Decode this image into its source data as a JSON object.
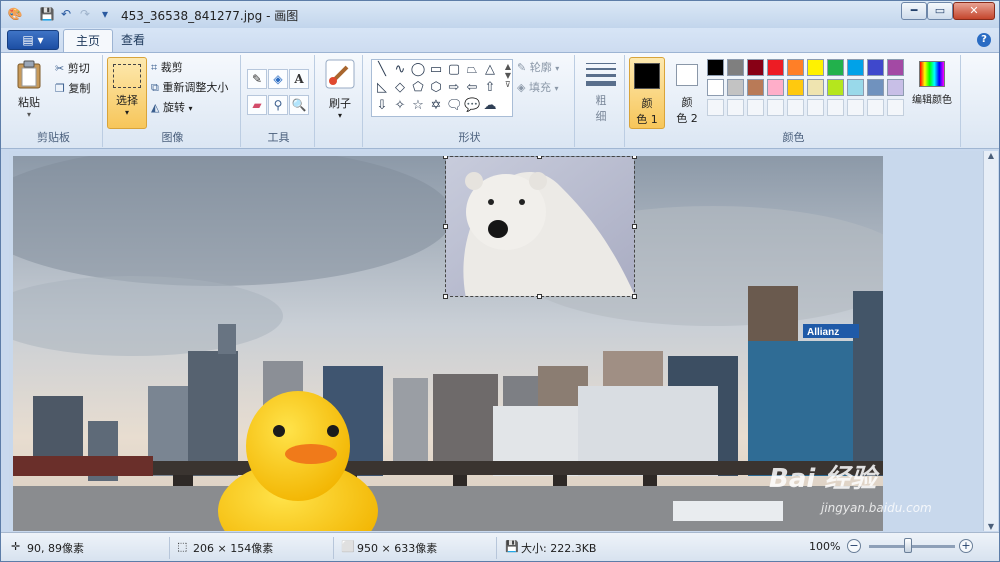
{
  "window": {
    "title": "453_36538_841277.jpg - 画图",
    "min_label": "━",
    "max_label": "▭",
    "close_label": "✕"
  },
  "quick_access": {
    "save": "💾",
    "undo": "↶",
    "redo": "↷",
    "dropdown": "▾"
  },
  "tabs": {
    "file": "▤ ▾",
    "home": "主页",
    "view": "查看",
    "help": "?"
  },
  "ribbon": {
    "clipboard": {
      "label": "剪贴板",
      "paste": "粘贴",
      "cut": "剪切",
      "copy": "复制"
    },
    "image": {
      "label": "图像",
      "select": "选择",
      "crop": "裁剪",
      "resize": "重新调整大小",
      "rotate": "旋转"
    },
    "tools": {
      "label": "工具"
    },
    "brush": {
      "label": "刷子"
    },
    "shapes": {
      "label": "形状",
      "outline": "轮廓",
      "fill": "填充"
    },
    "size": {
      "label1": "粗",
      "label2": "细"
    },
    "colors": {
      "label": "颜色",
      "color1": "颜\n色 1",
      "color1_a": "颜",
      "color1_b": "色 1",
      "color2_a": "颜",
      "color2_b": "色 2",
      "edit_colors": "编辑颜色",
      "color1_value": "#000000",
      "color2_value": "#ffffff",
      "palette_row1": [
        "#000000",
        "#7f7f7f",
        "#880015",
        "#ed1c24",
        "#ff7f27",
        "#fff200",
        "#22b14c",
        "#00a2e8",
        "#3f48cc",
        "#a349a4"
      ],
      "palette_row2": [
        "#ffffff",
        "#c3c3c3",
        "#b97a57",
        "#ffaec9",
        "#ffc90e",
        "#efe4b0",
        "#b5e61d",
        "#99d9ea",
        "#7092be",
        "#c8bfe7"
      ]
    }
  },
  "status": {
    "cursor": "90, 89像素",
    "selection": "206 × 154像素",
    "canvas_size": "950 × 633像素",
    "file_size": "大小: 222.3KB",
    "zoom": "100%",
    "zoom_out": "−",
    "zoom_in": "+"
  },
  "watermark": {
    "text": "Bai 经验",
    "sub": "jingyan.baidu.com"
  },
  "photo": {
    "building_sign": "Allianz"
  }
}
